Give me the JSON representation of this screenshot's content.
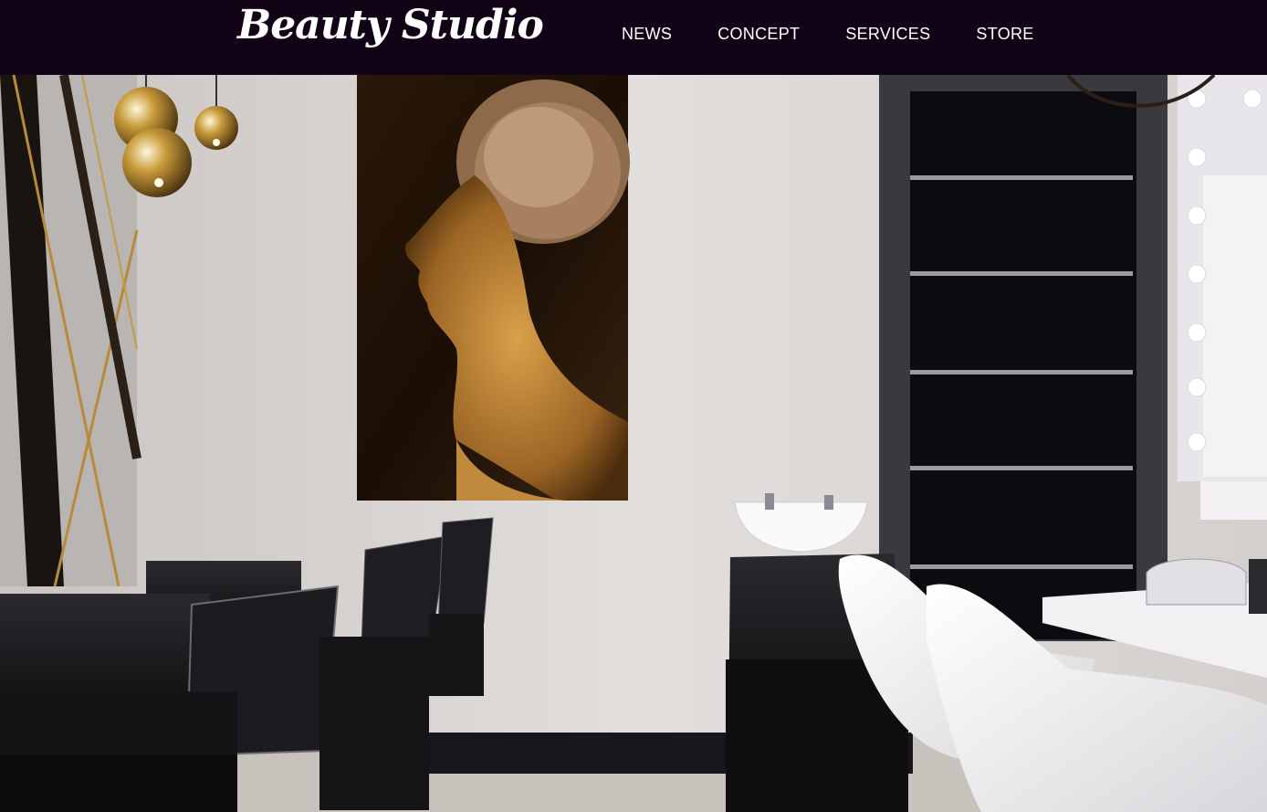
{
  "header": {
    "logo_text": "Beauty Studio",
    "background": "#120216",
    "nav": [
      {
        "label": "NEWS",
        "name": "nav-news"
      },
      {
        "label": "CONCEPT",
        "name": "nav-concept"
      },
      {
        "label": "SERVICES",
        "name": "nav-services"
      },
      {
        "label": "STORE",
        "name": "nav-store"
      }
    ]
  },
  "hero": {
    "scene": "salon-interior-photo"
  }
}
